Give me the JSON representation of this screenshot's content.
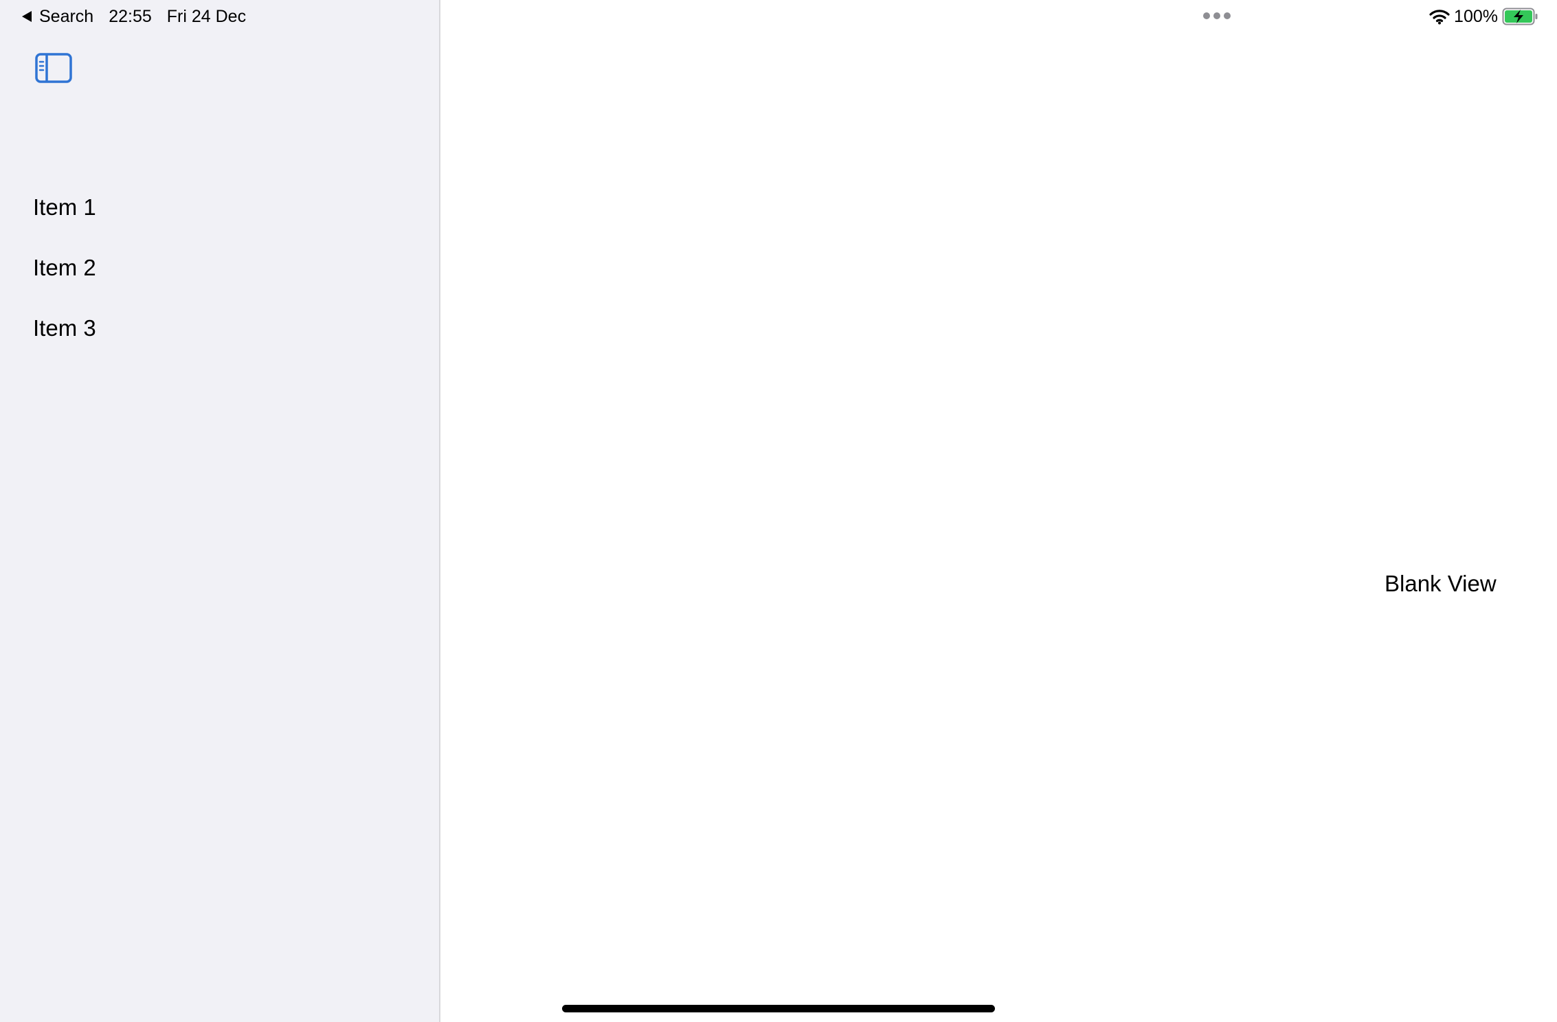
{
  "status_bar": {
    "back_label": "Search",
    "time": "22:55",
    "date": "Fri 24 Dec",
    "battery_percent": "100%",
    "battery_level": 1.0,
    "battery_charging": true,
    "icons": [
      "back-arrow-icon",
      "wifi-icon",
      "battery-charging-icon",
      "multitask-dots-icon"
    ]
  },
  "sidebar": {
    "toggle_icon": "sidebar-toggle-icon",
    "items": [
      {
        "label": "Item 1"
      },
      {
        "label": "Item 2"
      },
      {
        "label": "Item 3"
      }
    ]
  },
  "detail": {
    "label": "Blank View"
  },
  "colors": {
    "accent": "#2f74d4",
    "sidebar_background": "#f1f1f6",
    "battery_fill": "#34c759"
  }
}
